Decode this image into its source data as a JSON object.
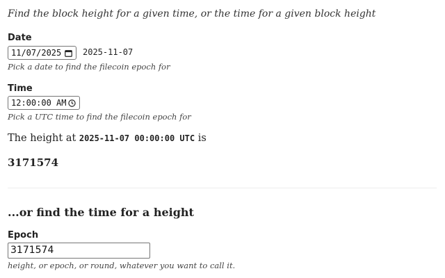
{
  "intro": "Find the block height for a given time, or the time for a given block height",
  "date_section": {
    "label": "Date",
    "input_value": "11/07/2025",
    "echo_value": "2025-11-07",
    "hint": "Pick a date to find the filecoin epoch for",
    "icon": "calendar-icon"
  },
  "time_section": {
    "label": "Time",
    "input_value": "12:00:00 AM",
    "hint": "Pick a UTC time to find the filecoin epoch for",
    "icon": "clock-icon"
  },
  "result": {
    "prefix": "The height at",
    "timestamp": "2025-11-07 00:00:00 UTC",
    "suffix": "is",
    "height": "3171574"
  },
  "reverse_section": {
    "heading": "...or find the time for a height",
    "label": "Epoch",
    "input_value": "3171574",
    "hint": "height, or epoch, or round, whatever you want to call it."
  }
}
